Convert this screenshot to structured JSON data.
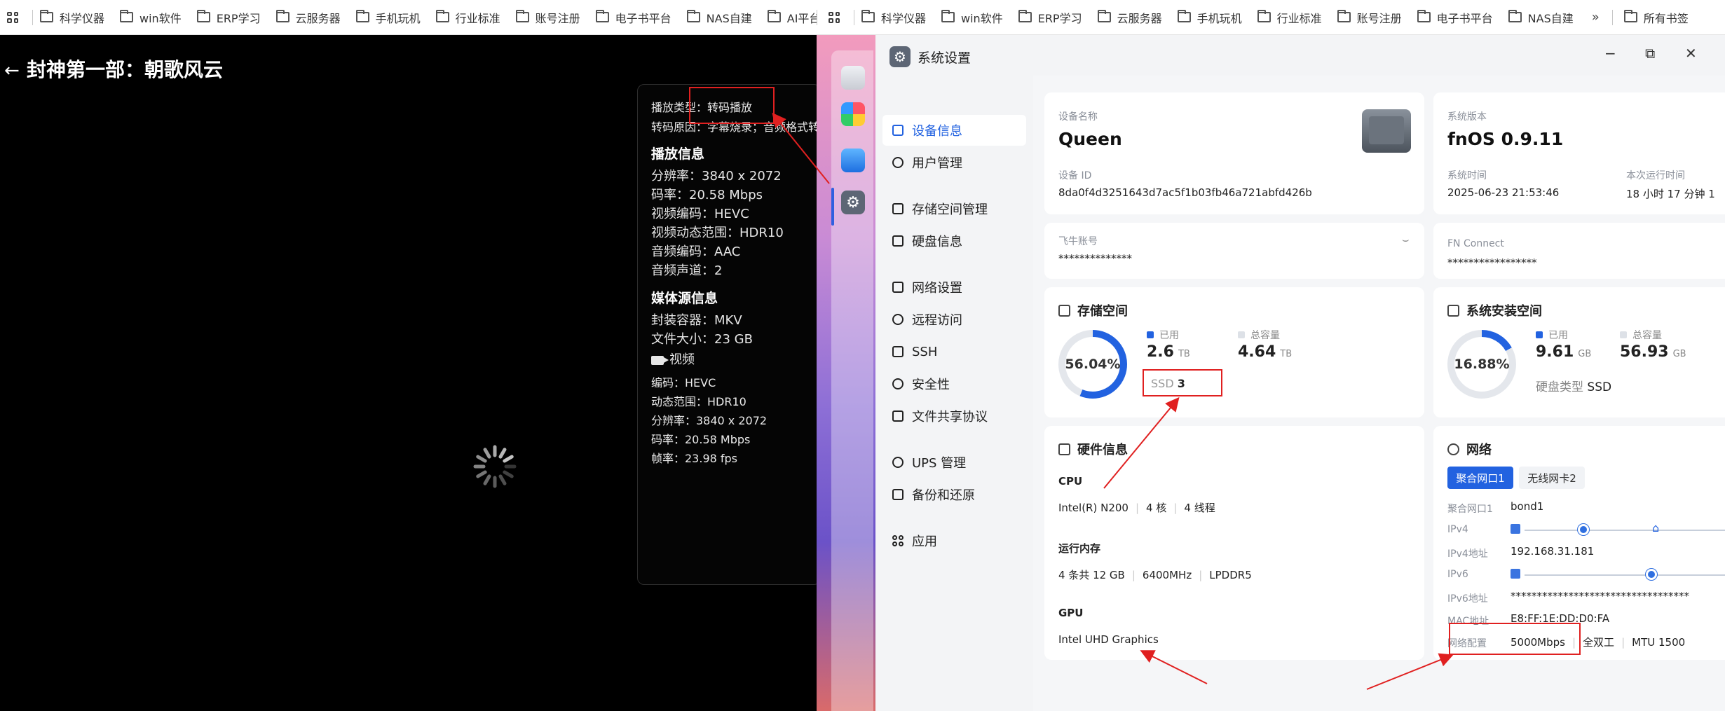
{
  "left_bookmarks": [
    "科学仪器",
    "win软件",
    "ERP学习",
    "云服务器",
    "手机玩机",
    "行业标准",
    "账号注册",
    "电子书平台",
    "NAS自建",
    "AI平台"
  ],
  "right_bookmarks": [
    "科学仪器",
    "win软件",
    "ERP学习",
    "云服务器",
    "手机玩机",
    "行业标准",
    "账号注册",
    "电子书平台",
    "NAS自建"
  ],
  "right_more": "»",
  "right_all_bookmarks": "所有书签",
  "player": {
    "back": "←",
    "title": "封神第一部：朝歌风云",
    "play_type": "播放类型：转码播放",
    "transcode_reason": "转码原因：字幕烧录；音频格式转",
    "play_info_title": "播放信息",
    "play_info": [
      "分辨率：3840 x 2072",
      "码率：20.58 Mbps",
      "视频编码：HEVC",
      "视频动态范围：HDR10",
      "音频编码：AAC",
      "音频声道：2"
    ],
    "media_title": "媒体源信息",
    "media_info": [
      "封装容器：MKV",
      "文件大小：23 GB"
    ],
    "video_label": "视频",
    "video_info": [
      "编码：HEVC",
      "动态范围：HDR10",
      "分辨率：3840 x 2072",
      "码率：20.58 Mbps",
      "帧率：23.98 fps"
    ]
  },
  "window": {
    "title": "系统设置",
    "minimize": "−",
    "maximize": "⧉",
    "close": "✕",
    "sidebar": [
      "设备信息",
      "用户管理",
      "存储空间管理",
      "硬盘信息",
      "网络设置",
      "远程访问",
      "SSH",
      "安全性",
      "文件共享协议",
      "UPS 管理",
      "备份和还原",
      "应用"
    ],
    "device": {
      "name_label": "设备名称",
      "name": "Queen",
      "id_label": "设备 ID",
      "id": "8da0f4d3251643d7ac5f1b03fb46a721abfd426b",
      "os_label": "系统版本",
      "os": "fnOS  0.9.11",
      "time_label": "系统时间",
      "time": "2025-06-23 21:53:46",
      "uptime_label": "本次运行时间",
      "uptime": "18 小时 17 分钟 1"
    },
    "account": {
      "label": "飞牛账号",
      "value": "**************"
    },
    "connect": {
      "label": "FN Connect",
      "value": "*****************"
    },
    "storage": {
      "title": "存储空间",
      "percent": "56.04%",
      "fraction": 0.5604,
      "used_label": "已用",
      "used": "2.6",
      "used_unit": "TB",
      "total_label": "总容量",
      "total": "4.64",
      "total_unit": "TB",
      "ssd_label": "SSD",
      "ssd_count": "3"
    },
    "sysspace": {
      "title": "系统安装空间",
      "percent": "16.88%",
      "fraction": 0.1688,
      "used_label": "已用",
      "used": "9.61",
      "used_unit": "GB",
      "total_label": "总容量",
      "total": "56.93",
      "total_unit": "GB",
      "disk_type_label": "硬盘类型",
      "disk_type": "SSD"
    },
    "hardware": {
      "title": "硬件信息",
      "cpu_label": "CPU",
      "cpu_model": "Intel(R) N200",
      "cpu_cores": "4 核",
      "cpu_threads": "4 线程",
      "mem_label": "运行内存",
      "mem_size": "4 条共 12 GB",
      "mem_speed": "6400MHz",
      "mem_type": "LPDDR5",
      "gpu_label": "GPU",
      "gpu_model": "Intel UHD Graphics"
    },
    "network": {
      "title": "网络",
      "tabs": [
        "聚合网口1",
        "无线网卡2"
      ],
      "agg_label": "聚合网口1",
      "agg_value": "bond1",
      "ipv4_label": "IPv4",
      "ipv4_addr_label": "IPv4地址",
      "ipv4_addr": "192.168.31.181",
      "ipv6_label": "IPv6",
      "ipv6_addr_label": "IPv6地址",
      "ipv6_addr": "**********************************",
      "mac_label": "MAC地址",
      "mac": "E8:FF:1E:DD:D0:FA",
      "config_label": "网络配置",
      "speed": "5000Mbps",
      "duplex": "全双工",
      "mtu": "MTU 1500"
    }
  },
  "colors": {
    "accent": "#2262e0",
    "donut_track": "#e4e7ec",
    "annotation": "#e02020"
  }
}
